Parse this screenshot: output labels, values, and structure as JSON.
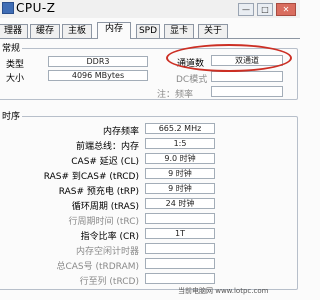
{
  "window": {
    "title": "CPU-Z",
    "minimize_glyph": "—",
    "maximize_glyph": "□",
    "close_glyph": "✕"
  },
  "tabs": [
    "理器",
    "缓存",
    "主板",
    "内存",
    "SPD",
    "显卡",
    "关于"
  ],
  "general": {
    "title": "常规",
    "type_label": "类型",
    "type_value": "DDR3",
    "size_label": "大小",
    "size_value": "4096 MBytes",
    "channels_label": "通道数",
    "channels_value": "双通道",
    "dc_mode_label": "DC模式",
    "note_label": "注：频率"
  },
  "timings": {
    "title": "时序",
    "rows": [
      {
        "label": "内存频率",
        "value": "665.2 MHz",
        "enabled": true
      },
      {
        "label": "前端总线：内存",
        "value": "1:5",
        "enabled": true
      },
      {
        "label": "CAS# 延迟 (CL)",
        "value": "9.0 时钟",
        "enabled": true
      },
      {
        "label": "RAS# 到CAS# (tRCD)",
        "value": "9 时钟",
        "enabled": true
      },
      {
        "label": "RAS# 预充电 (tRP)",
        "value": "9 时钟",
        "enabled": true
      },
      {
        "label": "循环周期 (tRAS)",
        "value": "24 时钟",
        "enabled": true
      },
      {
        "label": "行周期时间 (tRC)",
        "value": "",
        "enabled": false
      },
      {
        "label": "指令比率 (CR)",
        "value": "1T",
        "enabled": true
      },
      {
        "label": "内存空闲计时器",
        "value": "",
        "enabled": false
      },
      {
        "label": "总CAS号 (tRDRAM)",
        "value": "",
        "enabled": false
      },
      {
        "label": "行至列 (tRCD)",
        "value": "",
        "enabled": false
      }
    ]
  },
  "watermark": "当前电脑网 www.lotpc.com",
  "colors": {
    "highlight_oval": "#cc2f24"
  }
}
